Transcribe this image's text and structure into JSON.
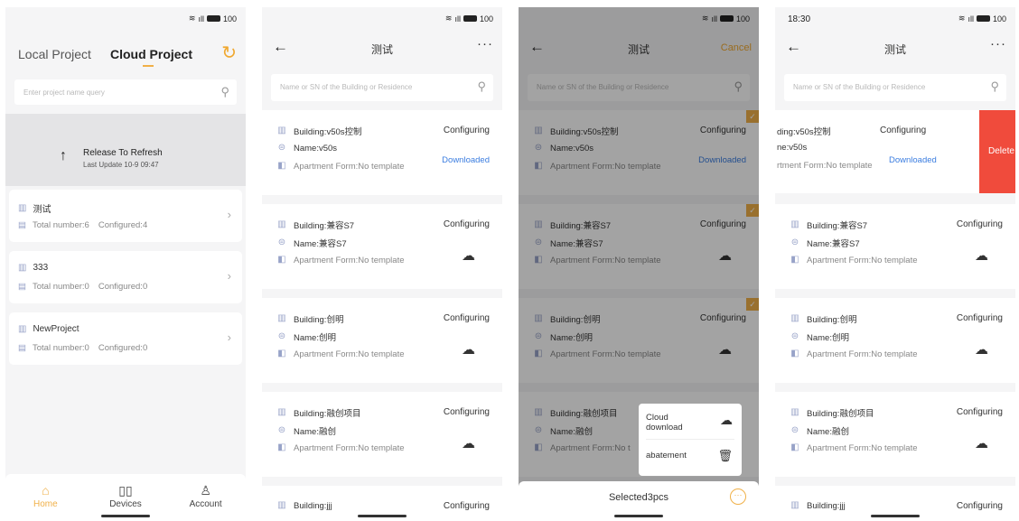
{
  "status_bar": {
    "time_s4": "18:30",
    "battery": "100"
  },
  "screen1": {
    "tab_local": "Local Project",
    "tab_cloud": "Cloud Project",
    "search_placeholder": "Enter project name query",
    "refresh_title": "Release To Refresh",
    "refresh_sub": "Last Update 10-9 09:47",
    "projects": [
      {
        "name": "测试",
        "total": "Total number:6",
        "configured": "Configured:4"
      },
      {
        "name": "333",
        "total": "Total number:0",
        "configured": "Configured:0"
      },
      {
        "name": "NewProject",
        "total": "Total number:0",
        "configured": "Configured:0"
      }
    ],
    "bottom_tabs": [
      {
        "label": "Home",
        "icon": "home-icon"
      },
      {
        "label": "Devices",
        "icon": "devices-icon"
      },
      {
        "label": "Account",
        "icon": "account-icon"
      }
    ]
  },
  "detail": {
    "title": "测试",
    "more": "···",
    "cancel": "Cancel",
    "search_placeholder": "Name or SN of the Building or Residence",
    "status": "Configuring",
    "downloaded": "Downloaded",
    "buildings": [
      {
        "building": "Building:v50s控制",
        "name": "Name:v50s",
        "form": "Apartment Form:No template"
      },
      {
        "building": "Building:兼容S7",
        "name": "Name:兼容S7",
        "form": "Apartment Form:No template"
      },
      {
        "building": "Building:创明",
        "name": "Name:创明",
        "form": "Apartment Form:No template"
      },
      {
        "building": "Building:融创项目",
        "name": "Name:融创",
        "form": "Apartment Form:No template"
      },
      {
        "building": "Building:jjj"
      }
    ],
    "swiped": {
      "building": "ding:v50s控制",
      "name": "ne:v50s",
      "form": "rtment Form:No template",
      "delete": "Delete"
    },
    "partial_form": "Apartment Form:No t",
    "popup": {
      "download": "Cloud\ndownload",
      "abatement": "abatement"
    },
    "selected": "Selected3pcs"
  },
  "colors": {
    "accent": "#f0b048",
    "link": "#3b7de0",
    "delete": "#f04b3c"
  }
}
